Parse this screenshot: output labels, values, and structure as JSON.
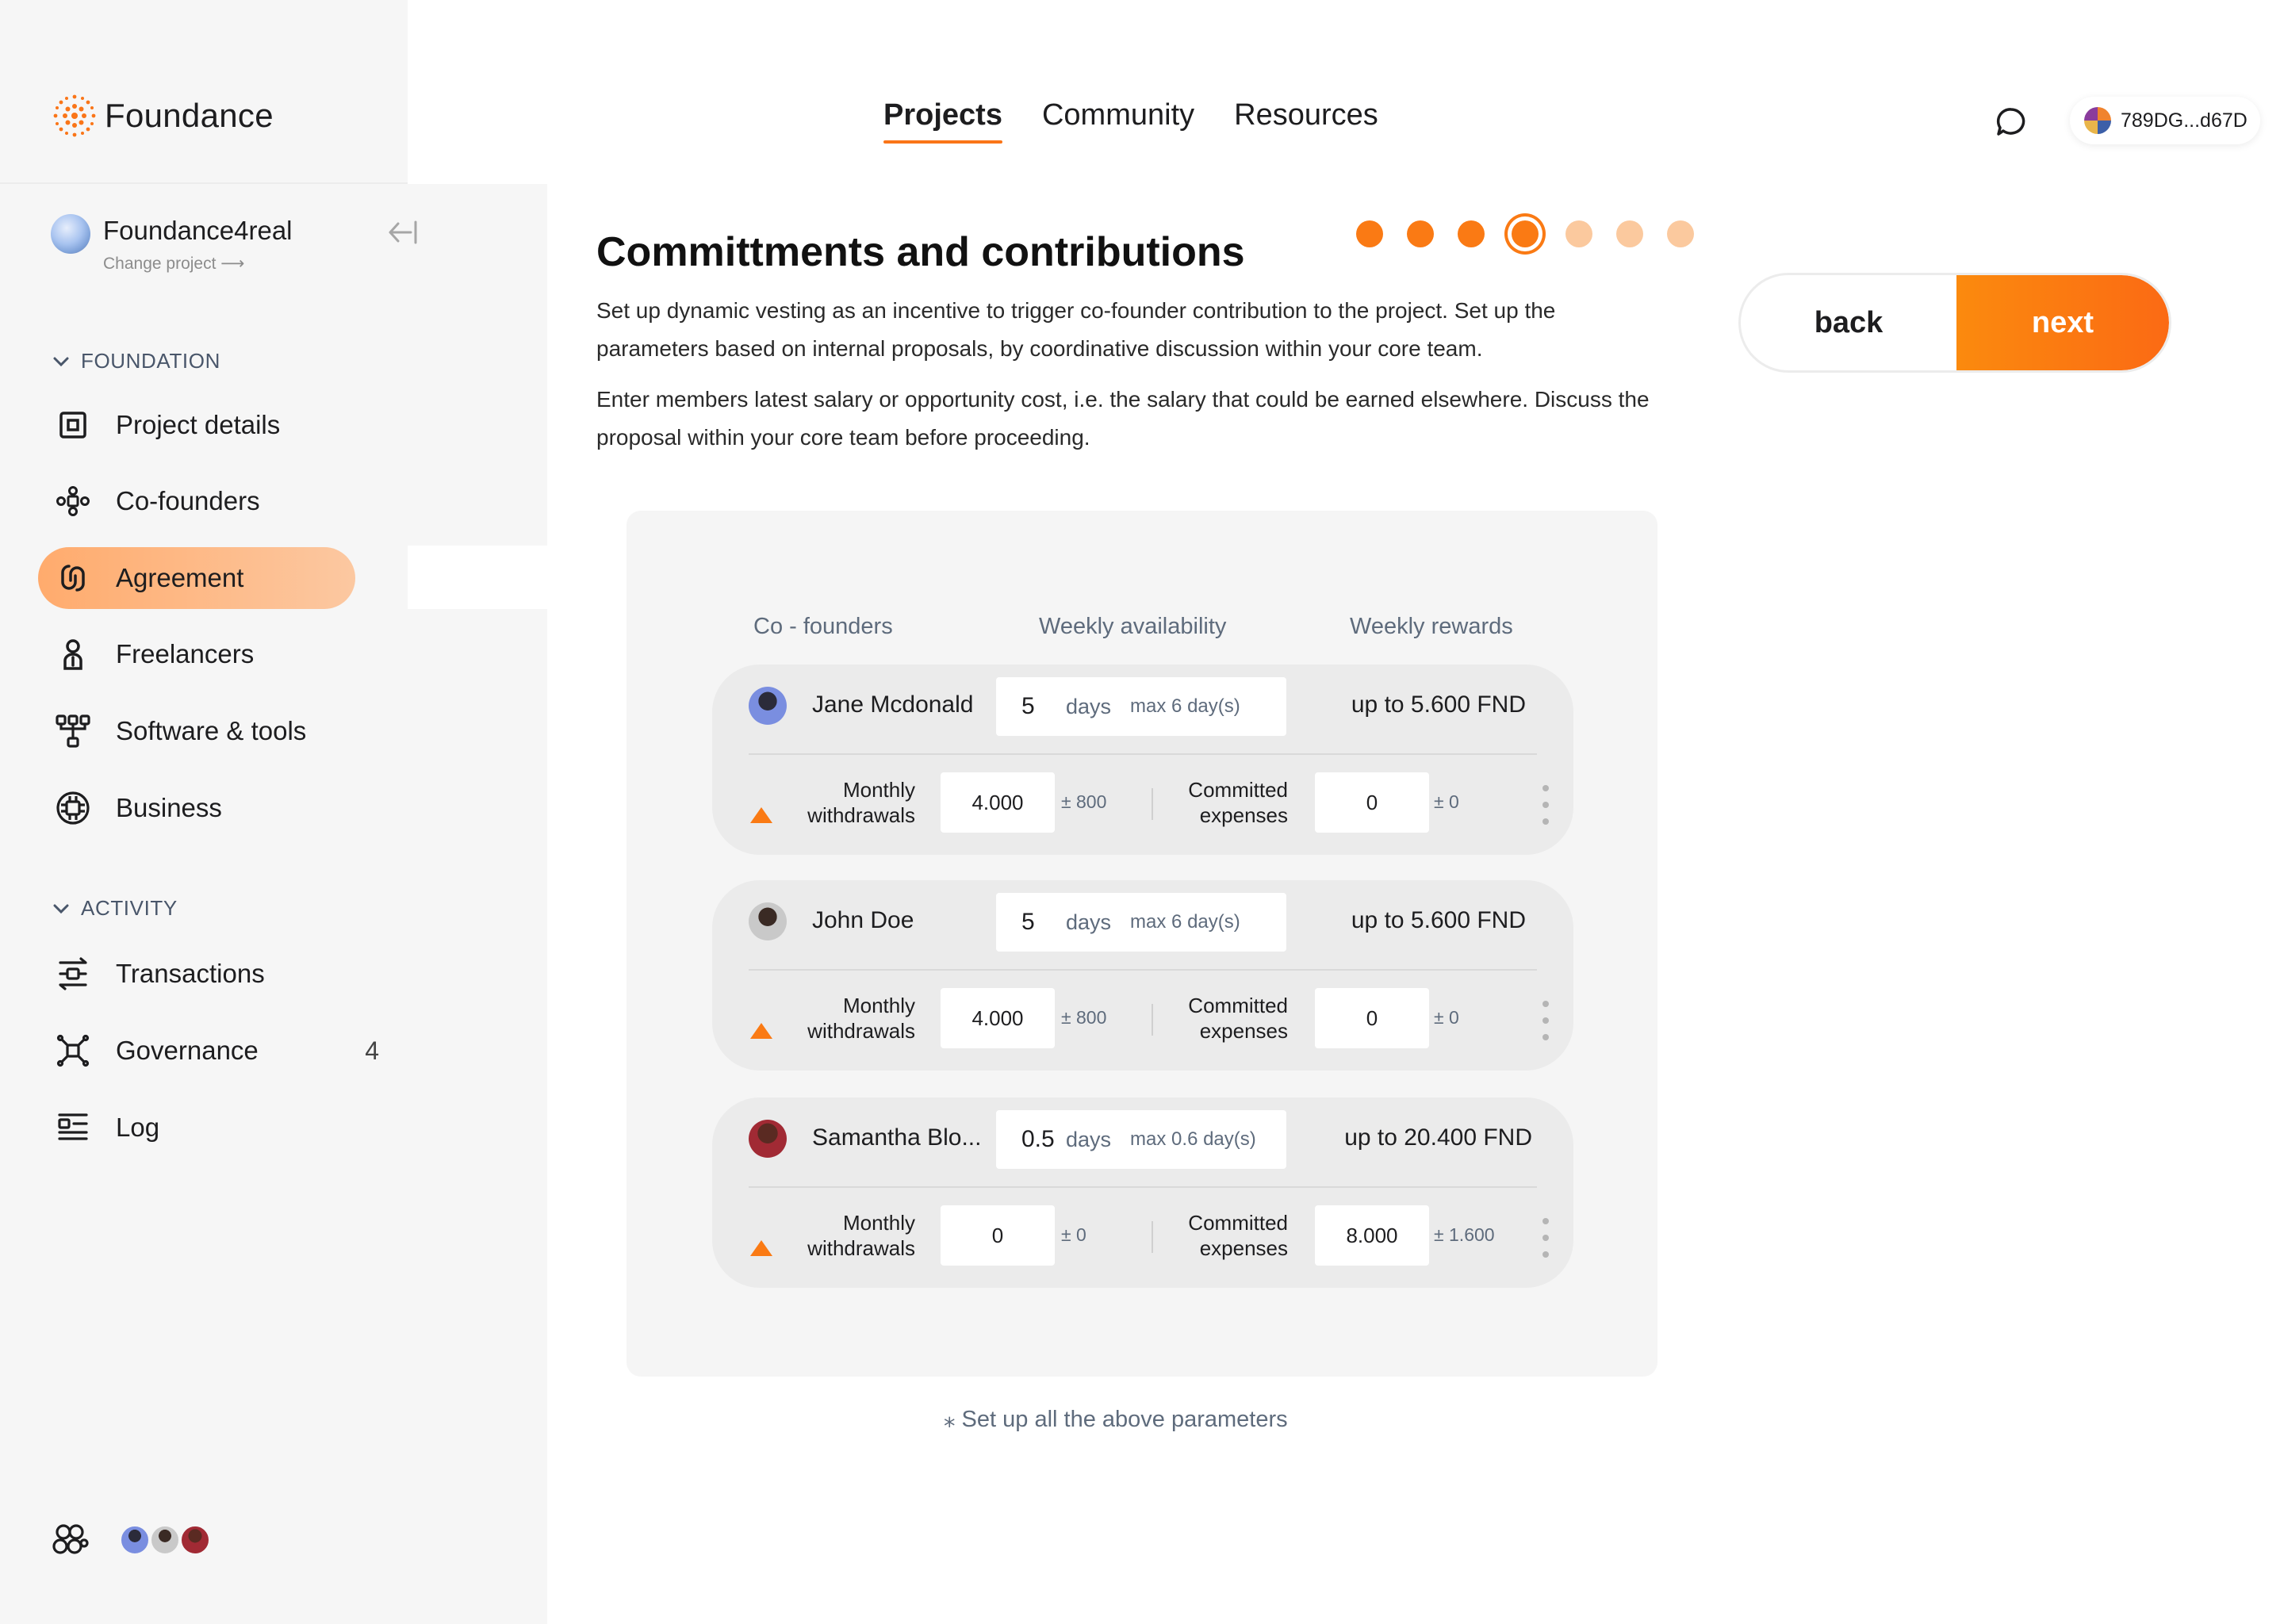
{
  "brand": {
    "name": "Foundance",
    "accent": "#fa7518"
  },
  "project": {
    "name": "Foundance4real",
    "change_label": "Change project ⟶"
  },
  "sidebar": {
    "sections": [
      {
        "label": "FOUNDATION"
      },
      {
        "label": "ACTIVITY"
      }
    ],
    "foundation_items": [
      {
        "label": "Project details",
        "icon": "project-details-icon"
      },
      {
        "label": "Co-founders",
        "icon": "cofounders-icon"
      },
      {
        "label": "Agreement",
        "icon": "agreement-icon",
        "active": true
      },
      {
        "label": "Freelancers",
        "icon": "freelancers-icon"
      },
      {
        "label": "Software & tools",
        "icon": "software-icon"
      },
      {
        "label": "Business",
        "icon": "business-icon"
      }
    ],
    "activity_items": [
      {
        "label": "Transactions",
        "icon": "transactions-icon"
      },
      {
        "label": "Governance",
        "icon": "governance-icon",
        "badge": "4"
      },
      {
        "label": "Log",
        "icon": "log-icon"
      }
    ]
  },
  "topnav": {
    "tabs": [
      {
        "label": "Projects",
        "active": true
      },
      {
        "label": "Community"
      },
      {
        "label": "Resources"
      }
    ],
    "wallet": "789DG...d67D"
  },
  "page": {
    "title": "Committments and contributions",
    "steps": {
      "total": 7,
      "current": 4
    },
    "desc1": "Set up dynamic vesting as an incentive to trigger co-founder contribution to the project. Set up the parameters based on internal proposals, by coordinative discussion within your core team.",
    "desc2": "Enter members latest salary or opportunity cost, i.e. the salary that could be earned elsewhere. Discuss the proposal within your core team before proceeding.",
    "back_label": "back",
    "next_label": "next",
    "footnote": "⁎  Set up all the above parameters"
  },
  "table": {
    "headers": {
      "cofounders": "Co - founders",
      "availability": "Weekly availability",
      "rewards": "Weekly rewards"
    },
    "withdrawals_label_1": "Monthly",
    "withdrawals_label_2": "withdrawals",
    "expenses_label_1": "Committed",
    "expenses_label_2": "expenses",
    "rows": [
      {
        "name": "Jane Mcdonald",
        "days": "5",
        "days_unit": "days",
        "max": "max 6 day(s)",
        "reward": "up to 5.600  FND",
        "withdrawals": "4.000",
        "withdrawals_var": "± 800",
        "expenses": "0",
        "expenses_var": "± 0"
      },
      {
        "name": "John Doe",
        "days": "5",
        "days_unit": "days",
        "max": "max 6 day(s)",
        "reward": "up to 5.600  FND",
        "withdrawals": "4.000",
        "withdrawals_var": "± 800",
        "expenses": "0",
        "expenses_var": "± 0"
      },
      {
        "name": "Samantha Blo...",
        "days": "0.5",
        "days_unit": "days",
        "max": "max 0.6 day(s)",
        "reward": "up to 20.400  FND",
        "withdrawals": "0",
        "withdrawals_var": "± 0",
        "expenses": "8.000",
        "expenses_var": "± 1.600"
      }
    ]
  }
}
